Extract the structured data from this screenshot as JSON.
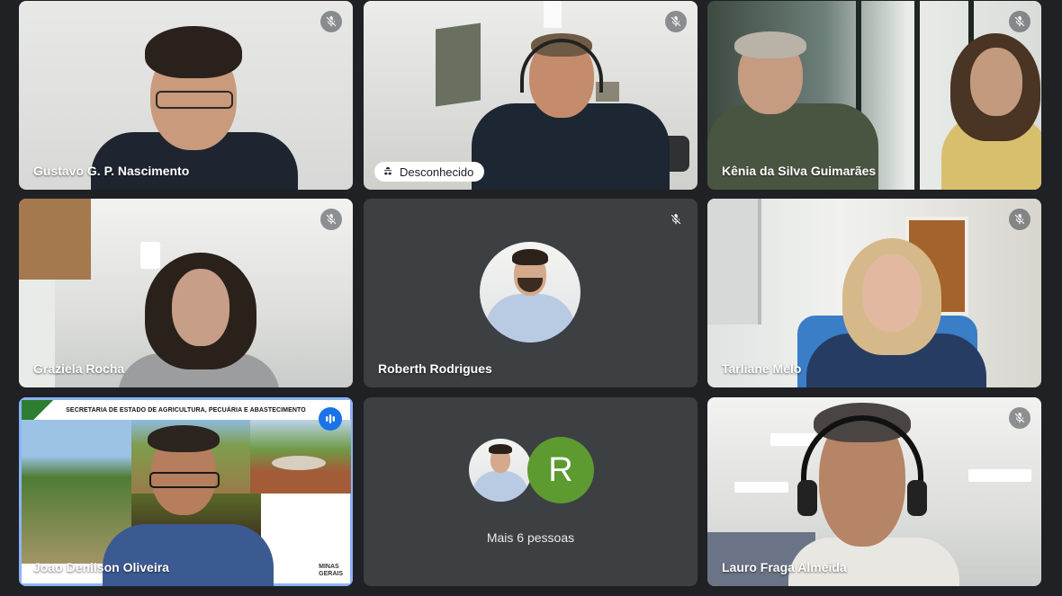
{
  "participants": [
    {
      "name": "Gustavo G. P. Nascimento",
      "muted": true
    },
    {
      "name": "Desconhecido",
      "muted": true
    },
    {
      "name": "Kênia da Silva Guimarães",
      "muted": true
    },
    {
      "name": "Graziela Rocha",
      "muted": true
    },
    {
      "name": "Roberth Rodrigues",
      "muted": true
    },
    {
      "name": "Tarliane Melo",
      "muted": true
    },
    {
      "name": "Joao Denilson Oliveira",
      "muted": false,
      "speaking": true
    },
    {
      "name": "Lauro Fraga Almeida",
      "muted": true
    }
  ],
  "slide": {
    "banner": "SECRETARIA DE ESTADO DE AGRICULTURA, PECUÁRIA E ABASTECIMENTO",
    "logo_line1": "MINAS",
    "logo_line2": "GERAIS"
  },
  "more_tile": {
    "avatar_letter": "R",
    "label": "Mais 6 pessoas",
    "avatar_color": "#5d9b31"
  },
  "icons": {
    "muted": "mic-off-icon",
    "speaking": "audio-level-icon",
    "unknown_user": "incognito-icon"
  },
  "colors": {
    "background": "#202124",
    "tile": "#3c4043",
    "speaking_outline": "#8ab4f8",
    "speaking_badge": "#1a73e8"
  }
}
